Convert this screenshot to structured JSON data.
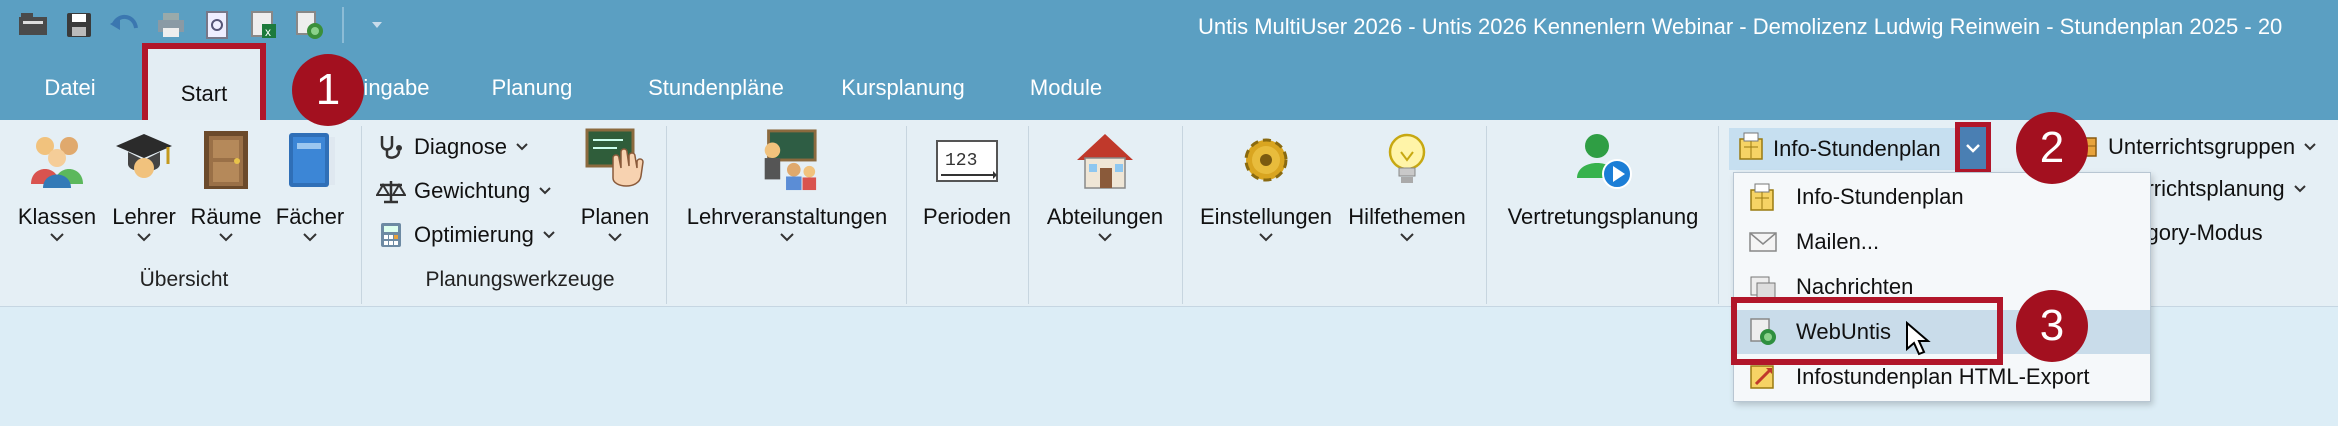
{
  "window": {
    "title": "Untis MultiUser 2026 - Untis 2026 Kennenlern Webinar  -  Demolizenz Ludwig Reinwein  -  Stundenplan 2025 - 20"
  },
  "quick_access": [
    "open-icon",
    "save-icon",
    "undo-icon",
    "print-icon",
    "print-preview-icon",
    "excel-export-icon",
    "web-export-icon",
    "customize-icon"
  ],
  "tabs": [
    {
      "label": "Datei"
    },
    {
      "label": "Start"
    },
    {
      "label": "Dateneingabe"
    },
    {
      "label": "Planung"
    },
    {
      "label": "Stundenpläne"
    },
    {
      "label": "Kursplanung"
    },
    {
      "label": "Module"
    }
  ],
  "groups": {
    "uebersicht": {
      "label": "Übersicht",
      "buttons": [
        {
          "label": "Klassen"
        },
        {
          "label": "Lehrer"
        },
        {
          "label": "Räume"
        },
        {
          "label": "Fächer"
        }
      ]
    },
    "planungswerkzeuge": {
      "label": "Planungswerkzeuge",
      "small": [
        {
          "label": "Diagnose"
        },
        {
          "label": "Gewichtung"
        },
        {
          "label": "Optimierung"
        }
      ],
      "planen": "Planen"
    },
    "lehrveranstaltungen": "Lehrveranstaltungen",
    "perioden": "Perioden",
    "abteilungen": "Abteilungen",
    "einstellungen": "Einstellungen",
    "hilfethemen": "Hilfethemen",
    "vertretungsplanung": "Vertretungsplanung",
    "info_stundenplan": "Info-Stundenplan",
    "right": [
      {
        "label": "Unterrichtsgruppen"
      },
      {
        "label": "Unterrichtsplanung"
      },
      {
        "label": "Category-Modus"
      }
    ]
  },
  "dropdown": {
    "items": [
      {
        "label": "Info-Stundenplan",
        "icon": "info-plan-icon"
      },
      {
        "label": "Mailen...",
        "icon": "mail-icon"
      },
      {
        "label": "Nachrichten",
        "icon": "messages-icon"
      },
      {
        "label": "WebUntis",
        "icon": "webuntis-icon"
      },
      {
        "label": "Infostundenplan HTML-Export",
        "icon": "html-export-icon"
      }
    ]
  },
  "markers": [
    "1",
    "2",
    "3"
  ],
  "colors": {
    "titlebar": "#5b9fc2",
    "ribbon": "#e5eff5",
    "content": "#dcedf6",
    "highlight": "#b1162a"
  }
}
